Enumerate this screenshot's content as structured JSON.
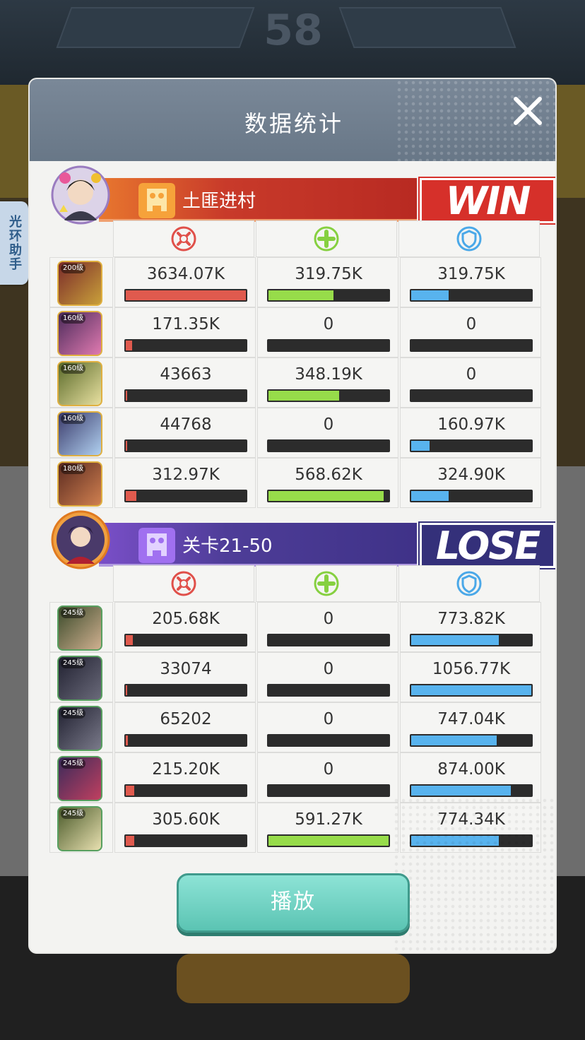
{
  "background": {
    "top_number": "58"
  },
  "side_tab": {
    "label": "光环助手"
  },
  "dialog": {
    "title": "数据统计",
    "play_label": "播放"
  },
  "colors": {
    "damage": "#e05a4e",
    "heal": "#97dc4a",
    "shield": "#58b3ee",
    "team1_banner": "#c5382a",
    "team2_banner": "#4a3a8f"
  },
  "stat_icons": [
    "sword-crossed-icon",
    "plus-icon",
    "shield-icon"
  ],
  "teams": [
    {
      "name": "土匪进村",
      "result": "WIN",
      "heroes": [
        {
          "level": "200级",
          "damage": "3634.07K",
          "heal": "319.75K",
          "shield": "319.75K",
          "damage_fill": 1.0,
          "heal_fill": 0.54,
          "shield_fill": 0.31
        },
        {
          "level": "160级",
          "damage": "171.35K",
          "heal": "0",
          "shield": "0",
          "damage_fill": 0.05,
          "heal_fill": 0,
          "shield_fill": 0
        },
        {
          "level": "160级",
          "damage": "43663",
          "heal": "348.19K",
          "shield": "0",
          "damage_fill": 0.012,
          "heal_fill": 0.59,
          "shield_fill": 0
        },
        {
          "level": "160级",
          "damage": "44768",
          "heal": "0",
          "shield": "160.97K",
          "damage_fill": 0.012,
          "heal_fill": 0,
          "shield_fill": 0.15
        },
        {
          "level": "180级",
          "damage": "312.97K",
          "heal": "568.62K",
          "shield": "324.90K",
          "damage_fill": 0.09,
          "heal_fill": 0.96,
          "shield_fill": 0.31
        }
      ]
    },
    {
      "name": "关卡21-50",
      "result": "LOSE",
      "heroes": [
        {
          "level": "245级",
          "damage": "205.68K",
          "heal": "0",
          "shield": "773.82K",
          "damage_fill": 0.06,
          "heal_fill": 0,
          "shield_fill": 0.73
        },
        {
          "level": "245级",
          "damage": "33074",
          "heal": "0",
          "shield": "1056.77K",
          "damage_fill": 0.01,
          "heal_fill": 0,
          "shield_fill": 1.0
        },
        {
          "level": "245级",
          "damage": "65202",
          "heal": "0",
          "shield": "747.04K",
          "damage_fill": 0.02,
          "heal_fill": 0,
          "shield_fill": 0.71
        },
        {
          "level": "245级",
          "damage": "215.20K",
          "heal": "0",
          "shield": "874.00K",
          "damage_fill": 0.07,
          "heal_fill": 0,
          "shield_fill": 0.83
        },
        {
          "level": "245级",
          "damage": "305.60K",
          "heal": "591.27K",
          "shield": "774.34K",
          "damage_fill": 0.07,
          "heal_fill": 1.0,
          "shield_fill": 0.73
        }
      ]
    }
  ]
}
